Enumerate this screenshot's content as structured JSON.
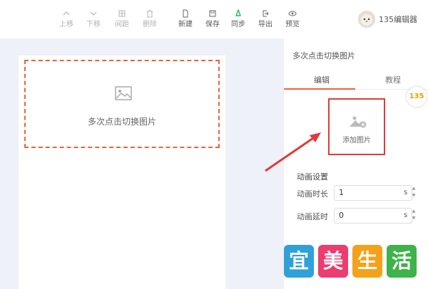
{
  "toolbar": {
    "move_up": "上移",
    "move_down": "下移",
    "spacing": "间距",
    "delete": "删除",
    "new": "新建",
    "save": "保存",
    "sync": "同步",
    "export": "导出",
    "preview": "预览"
  },
  "user": {
    "name": "135编辑器"
  },
  "canvas": {
    "hint": "多次点击切换图片"
  },
  "panel": {
    "title": "多次点击切换图片",
    "tabs": {
      "edit": "编辑",
      "tutorial": "教程"
    },
    "badge": "135",
    "add_image": "添加图片",
    "animation_settings": "动画设置",
    "duration_label": "动画时长",
    "duration_value": "1",
    "delay_label": "动画延时",
    "delay_value": "0",
    "unit": "s"
  },
  "watermark": [
    "宜",
    "美",
    "生",
    "活"
  ],
  "colors": {
    "accent": "#e8663a",
    "highlight_red": "#e03a3a",
    "sync_green": "#2db36a",
    "canvas_bg": "#eef1f7"
  }
}
